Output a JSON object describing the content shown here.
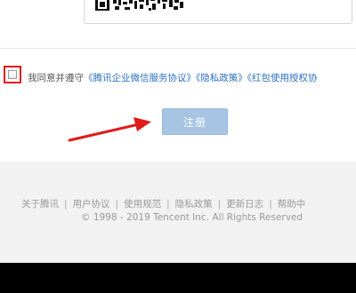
{
  "agreement": {
    "prefix": "我同意并遵守",
    "link1": "《腾讯企业微信服务协议》",
    "link2": "《隐私政策》",
    "link3": "《红包使用授权协"
  },
  "register_label": "注册",
  "footer": {
    "links": [
      "关于腾讯",
      "用户协议",
      "使用规范",
      "隐私政策",
      "更新日志",
      "帮助中"
    ],
    "separator": "|",
    "copyright": "© 1998 - 2019 Tencent Inc. All Rights Reserved"
  },
  "colors": {
    "link": "#2b6fc2",
    "register_button": "#a7c5e3",
    "annotation_red": "#e01b1b",
    "footer_bg": "#f2f2f2"
  }
}
